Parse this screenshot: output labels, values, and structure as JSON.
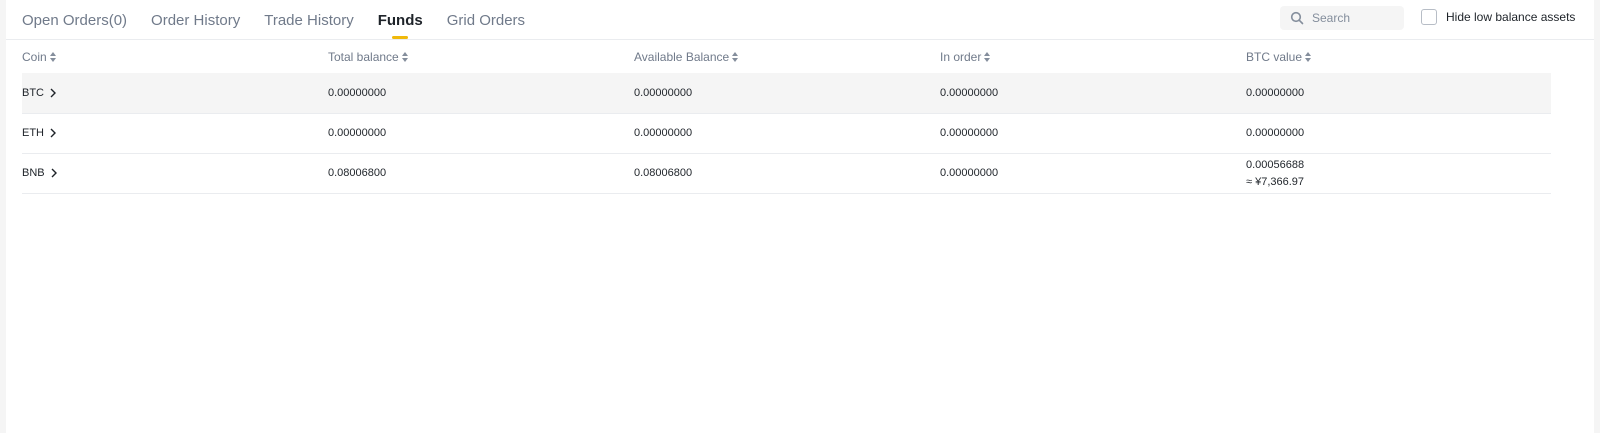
{
  "tabs": [
    {
      "label": "Open Orders(0)",
      "active": false
    },
    {
      "label": "Order History",
      "active": false
    },
    {
      "label": "Trade History",
      "active": false
    },
    {
      "label": "Funds",
      "active": true
    },
    {
      "label": "Grid Orders",
      "active": false
    }
  ],
  "search": {
    "placeholder": "Search",
    "value": ""
  },
  "hide_low_balance": {
    "label": "Hide low balance assets",
    "checked": false
  },
  "table": {
    "columns": [
      "Coin",
      "Total balance",
      "Available Balance",
      "In order",
      "BTC value"
    ],
    "rows": [
      {
        "coin": "BTC",
        "total": "0.00000000",
        "available": "0.00000000",
        "in_order": "0.00000000",
        "btc_value": "0.00000000",
        "fiat": ""
      },
      {
        "coin": "ETH",
        "total": "0.00000000",
        "available": "0.00000000",
        "in_order": "0.00000000",
        "btc_value": "0.00000000",
        "fiat": ""
      },
      {
        "coin": "BNB",
        "total": "0.08006800",
        "available": "0.08006800",
        "in_order": "0.00000000",
        "btc_value": "0.00056688",
        "fiat": "≈ ¥7,366.97"
      }
    ]
  },
  "icons": {
    "search": "search-icon",
    "sort": "sort-icon",
    "expand": "chevron-right-icon"
  },
  "colors": {
    "accent": "#f0b90b",
    "text": "#1e2329",
    "muted": "#707a8a",
    "row_highlight": "#f5f5f5"
  }
}
